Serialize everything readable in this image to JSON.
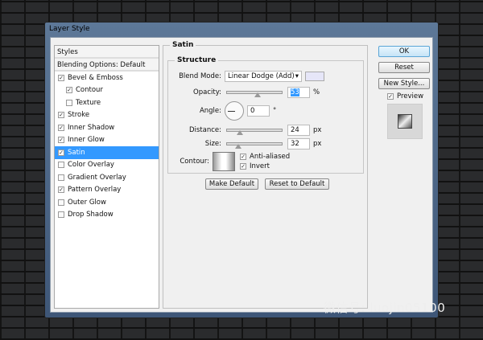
{
  "window": {
    "title": "Layer Style"
  },
  "sidebar": {
    "header": "Styles",
    "blending": "Blending Options: Default",
    "items": [
      {
        "label": "Bevel & Emboss",
        "checked": true,
        "sub": false
      },
      {
        "label": "Contour",
        "checked": true,
        "sub": true
      },
      {
        "label": "Texture",
        "checked": false,
        "sub": true
      },
      {
        "label": "Stroke",
        "checked": true,
        "sub": false
      },
      {
        "label": "Inner Shadow",
        "checked": true,
        "sub": false
      },
      {
        "label": "Inner Glow",
        "checked": true,
        "sub": false
      },
      {
        "label": "Satin",
        "checked": true,
        "sub": false,
        "selected": true
      },
      {
        "label": "Color Overlay",
        "checked": false,
        "sub": false
      },
      {
        "label": "Gradient Overlay",
        "checked": false,
        "sub": false
      },
      {
        "label": "Pattern Overlay",
        "checked": true,
        "sub": false
      },
      {
        "label": "Outer Glow",
        "checked": false,
        "sub": false
      },
      {
        "label": "Drop Shadow",
        "checked": false,
        "sub": false
      }
    ]
  },
  "satin": {
    "title": "Satin",
    "structure": "Structure",
    "blend_label": "Blend Mode:",
    "blend_value": "Linear Dodge (Add)",
    "blend_color": "#e6e6f8",
    "opacity_label": "Opacity:",
    "opacity": "53",
    "opacity_unit": "%",
    "angle_label": "Angle:",
    "angle": "0",
    "angle_unit": "°",
    "distance_label": "Distance:",
    "distance": "24",
    "distance_unit": "px",
    "size_label": "Size:",
    "size": "32",
    "size_unit": "px",
    "contour_label": "Contour:",
    "antialiased": "Anti-aliased",
    "invert": "Invert",
    "make_default": "Make Default",
    "reset_default": "Reset to Default"
  },
  "buttons": {
    "ok": "OK",
    "reset": "Reset",
    "new_style": "New Style...",
    "preview": "Preview"
  },
  "watermark": "微信号: luojin05100"
}
